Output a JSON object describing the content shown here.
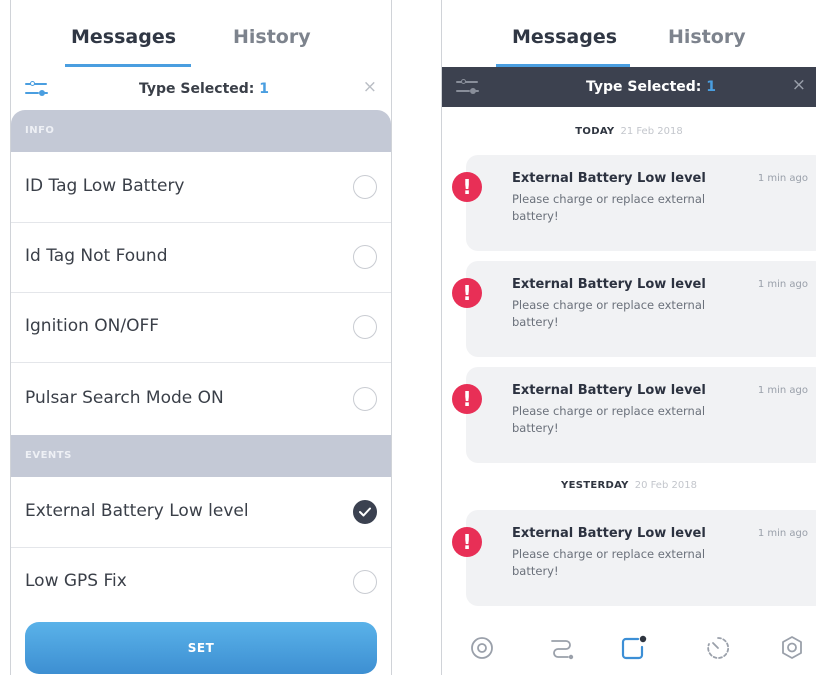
{
  "left": {
    "tabs": [
      {
        "label": "Messages"
      },
      {
        "label": "History"
      }
    ],
    "filter": {
      "label": "Type Selected:",
      "count": "1",
      "close": "×"
    },
    "sections": {
      "info": {
        "title": "INFO",
        "items": [
          {
            "label": "ID Tag Low Battery",
            "checked": false
          },
          {
            "label": "Id Tag Not Found",
            "checked": false
          },
          {
            "label": "Ignition ON/OFF",
            "checked": false
          },
          {
            "label": "Pulsar Search Mode ON",
            "checked": false
          }
        ]
      },
      "events": {
        "title": "EVENTS",
        "items": [
          {
            "label": "External Battery Low level",
            "checked": true
          },
          {
            "label": "Low GPS Fix",
            "checked": false
          }
        ]
      }
    },
    "set_label": "SET"
  },
  "right": {
    "tabs": [
      {
        "label": "Messages"
      },
      {
        "label": "History"
      }
    ],
    "filter": {
      "label": "Type Selected:",
      "count": "1",
      "close": "×"
    },
    "groups": [
      {
        "day": "TODAY",
        "date": "21 Feb 2018"
      },
      {
        "day": "YESTERDAY",
        "date": "20 Feb 2018"
      }
    ],
    "messages": [
      {
        "icon": "!",
        "title": "External Battery Low level",
        "time": "1 min ago",
        "body": "Please charge or replace external battery!"
      },
      {
        "icon": "!",
        "title": "External Battery Low level",
        "time": "1 min ago",
        "body": "Please charge or replace external battery!"
      },
      {
        "icon": "!",
        "title": "External Battery Low level",
        "time": "1 min ago",
        "body": "Please charge or replace external battery!"
      },
      {
        "icon": "!",
        "title": "External Battery Low level",
        "time": "1 min ago",
        "body": "Please charge or replace external battery!"
      }
    ],
    "nav_icons": [
      "target-icon",
      "route-icon",
      "messages-icon",
      "timer-icon",
      "settings-icon"
    ]
  },
  "colors": {
    "accent": "#4a9ee0",
    "alert": "#e82f56",
    "dark_bar": "#3c414f",
    "section": "#c4c9d6"
  }
}
